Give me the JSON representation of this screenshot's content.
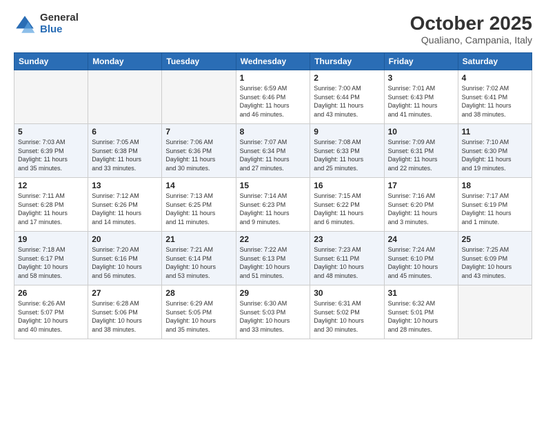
{
  "logo": {
    "general": "General",
    "blue": "Blue"
  },
  "header": {
    "month": "October 2025",
    "location": "Qualiano, Campania, Italy"
  },
  "weekdays": [
    "Sunday",
    "Monday",
    "Tuesday",
    "Wednesday",
    "Thursday",
    "Friday",
    "Saturday"
  ],
  "weeks": [
    [
      {
        "day": "",
        "info": ""
      },
      {
        "day": "",
        "info": ""
      },
      {
        "day": "",
        "info": ""
      },
      {
        "day": "1",
        "info": "Sunrise: 6:59 AM\nSunset: 6:46 PM\nDaylight: 11 hours\nand 46 minutes."
      },
      {
        "day": "2",
        "info": "Sunrise: 7:00 AM\nSunset: 6:44 PM\nDaylight: 11 hours\nand 43 minutes."
      },
      {
        "day": "3",
        "info": "Sunrise: 7:01 AM\nSunset: 6:43 PM\nDaylight: 11 hours\nand 41 minutes."
      },
      {
        "day": "4",
        "info": "Sunrise: 7:02 AM\nSunset: 6:41 PM\nDaylight: 11 hours\nand 38 minutes."
      }
    ],
    [
      {
        "day": "5",
        "info": "Sunrise: 7:03 AM\nSunset: 6:39 PM\nDaylight: 11 hours\nand 35 minutes."
      },
      {
        "day": "6",
        "info": "Sunrise: 7:05 AM\nSunset: 6:38 PM\nDaylight: 11 hours\nand 33 minutes."
      },
      {
        "day": "7",
        "info": "Sunrise: 7:06 AM\nSunset: 6:36 PM\nDaylight: 11 hours\nand 30 minutes."
      },
      {
        "day": "8",
        "info": "Sunrise: 7:07 AM\nSunset: 6:34 PM\nDaylight: 11 hours\nand 27 minutes."
      },
      {
        "day": "9",
        "info": "Sunrise: 7:08 AM\nSunset: 6:33 PM\nDaylight: 11 hours\nand 25 minutes."
      },
      {
        "day": "10",
        "info": "Sunrise: 7:09 AM\nSunset: 6:31 PM\nDaylight: 11 hours\nand 22 minutes."
      },
      {
        "day": "11",
        "info": "Sunrise: 7:10 AM\nSunset: 6:30 PM\nDaylight: 11 hours\nand 19 minutes."
      }
    ],
    [
      {
        "day": "12",
        "info": "Sunrise: 7:11 AM\nSunset: 6:28 PM\nDaylight: 11 hours\nand 17 minutes."
      },
      {
        "day": "13",
        "info": "Sunrise: 7:12 AM\nSunset: 6:26 PM\nDaylight: 11 hours\nand 14 minutes."
      },
      {
        "day": "14",
        "info": "Sunrise: 7:13 AM\nSunset: 6:25 PM\nDaylight: 11 hours\nand 11 minutes."
      },
      {
        "day": "15",
        "info": "Sunrise: 7:14 AM\nSunset: 6:23 PM\nDaylight: 11 hours\nand 9 minutes."
      },
      {
        "day": "16",
        "info": "Sunrise: 7:15 AM\nSunset: 6:22 PM\nDaylight: 11 hours\nand 6 minutes."
      },
      {
        "day": "17",
        "info": "Sunrise: 7:16 AM\nSunset: 6:20 PM\nDaylight: 11 hours\nand 3 minutes."
      },
      {
        "day": "18",
        "info": "Sunrise: 7:17 AM\nSunset: 6:19 PM\nDaylight: 11 hours\nand 1 minute."
      }
    ],
    [
      {
        "day": "19",
        "info": "Sunrise: 7:18 AM\nSunset: 6:17 PM\nDaylight: 10 hours\nand 58 minutes."
      },
      {
        "day": "20",
        "info": "Sunrise: 7:20 AM\nSunset: 6:16 PM\nDaylight: 10 hours\nand 56 minutes."
      },
      {
        "day": "21",
        "info": "Sunrise: 7:21 AM\nSunset: 6:14 PM\nDaylight: 10 hours\nand 53 minutes."
      },
      {
        "day": "22",
        "info": "Sunrise: 7:22 AM\nSunset: 6:13 PM\nDaylight: 10 hours\nand 51 minutes."
      },
      {
        "day": "23",
        "info": "Sunrise: 7:23 AM\nSunset: 6:11 PM\nDaylight: 10 hours\nand 48 minutes."
      },
      {
        "day": "24",
        "info": "Sunrise: 7:24 AM\nSunset: 6:10 PM\nDaylight: 10 hours\nand 45 minutes."
      },
      {
        "day": "25",
        "info": "Sunrise: 7:25 AM\nSunset: 6:09 PM\nDaylight: 10 hours\nand 43 minutes."
      }
    ],
    [
      {
        "day": "26",
        "info": "Sunrise: 6:26 AM\nSunset: 5:07 PM\nDaylight: 10 hours\nand 40 minutes."
      },
      {
        "day": "27",
        "info": "Sunrise: 6:28 AM\nSunset: 5:06 PM\nDaylight: 10 hours\nand 38 minutes."
      },
      {
        "day": "28",
        "info": "Sunrise: 6:29 AM\nSunset: 5:05 PM\nDaylight: 10 hours\nand 35 minutes."
      },
      {
        "day": "29",
        "info": "Sunrise: 6:30 AM\nSunset: 5:03 PM\nDaylight: 10 hours\nand 33 minutes."
      },
      {
        "day": "30",
        "info": "Sunrise: 6:31 AM\nSunset: 5:02 PM\nDaylight: 10 hours\nand 30 minutes."
      },
      {
        "day": "31",
        "info": "Sunrise: 6:32 AM\nSunset: 5:01 PM\nDaylight: 10 hours\nand 28 minutes."
      },
      {
        "day": "",
        "info": ""
      }
    ]
  ]
}
